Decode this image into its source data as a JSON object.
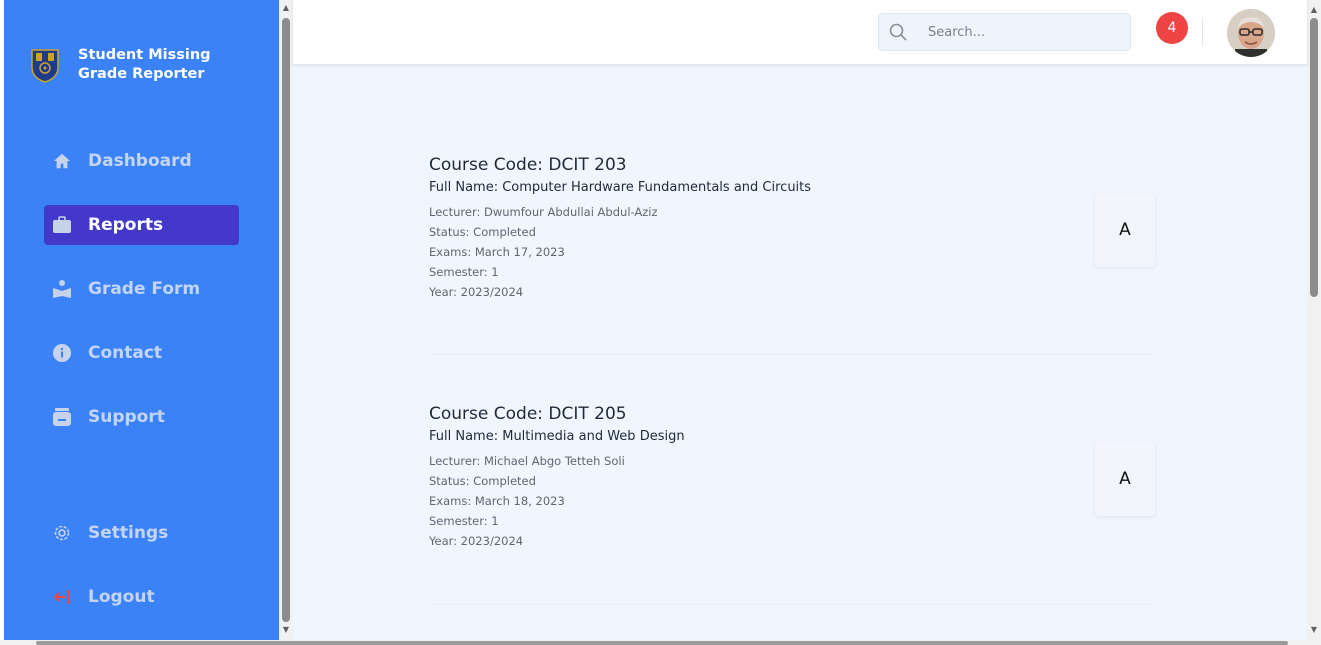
{
  "sidebar": {
    "brand_title": "Student Missing Grade Reporter",
    "items": [
      {
        "label": "Dashboard",
        "icon": "home-icon"
      },
      {
        "label": "Reports",
        "icon": "briefcase-icon",
        "active": true
      },
      {
        "label": "Grade Form",
        "icon": "reader-icon"
      },
      {
        "label": "Contact",
        "icon": "info-icon"
      },
      {
        "label": "Support",
        "icon": "inbox-icon"
      },
      {
        "label": "Settings",
        "icon": "gear-icon"
      },
      {
        "label": "Logout",
        "icon": "logout-icon"
      }
    ]
  },
  "header": {
    "search": {
      "placeholder": "Search...",
      "value": ""
    },
    "notification_count": "4"
  },
  "reports": [
    {
      "course_code": "Course Code: DCIT 203",
      "full_name": "Full Name: Computer Hardware Fundamentals and Circuits",
      "lecturer": "Lecturer: Dwumfour Abdullai Abdul-Aziz",
      "status": "Status: Completed",
      "exams": "Exams: March 17, 2023",
      "semester": "Semester: 1",
      "year": "Year: 2023/2024",
      "grade": "A"
    },
    {
      "course_code": "Course Code: DCIT 205",
      "full_name": "Full Name: Multimedia and Web Design",
      "lecturer": "Lecturer: Michael Abgo Tetteh Soli",
      "status": "Status: Completed",
      "exams": "Exams: March 18, 2023",
      "semester": "Semester: 1",
      "year": "Year: 2023/2024",
      "grade": "A"
    }
  ],
  "colors": {
    "sidebar_bg": "#3b82f6",
    "active_item_bg": "#4338ca",
    "main_bg": "#f0f6ff",
    "badge_bg": "#ef4444",
    "logout_icon": "#ef4444"
  }
}
